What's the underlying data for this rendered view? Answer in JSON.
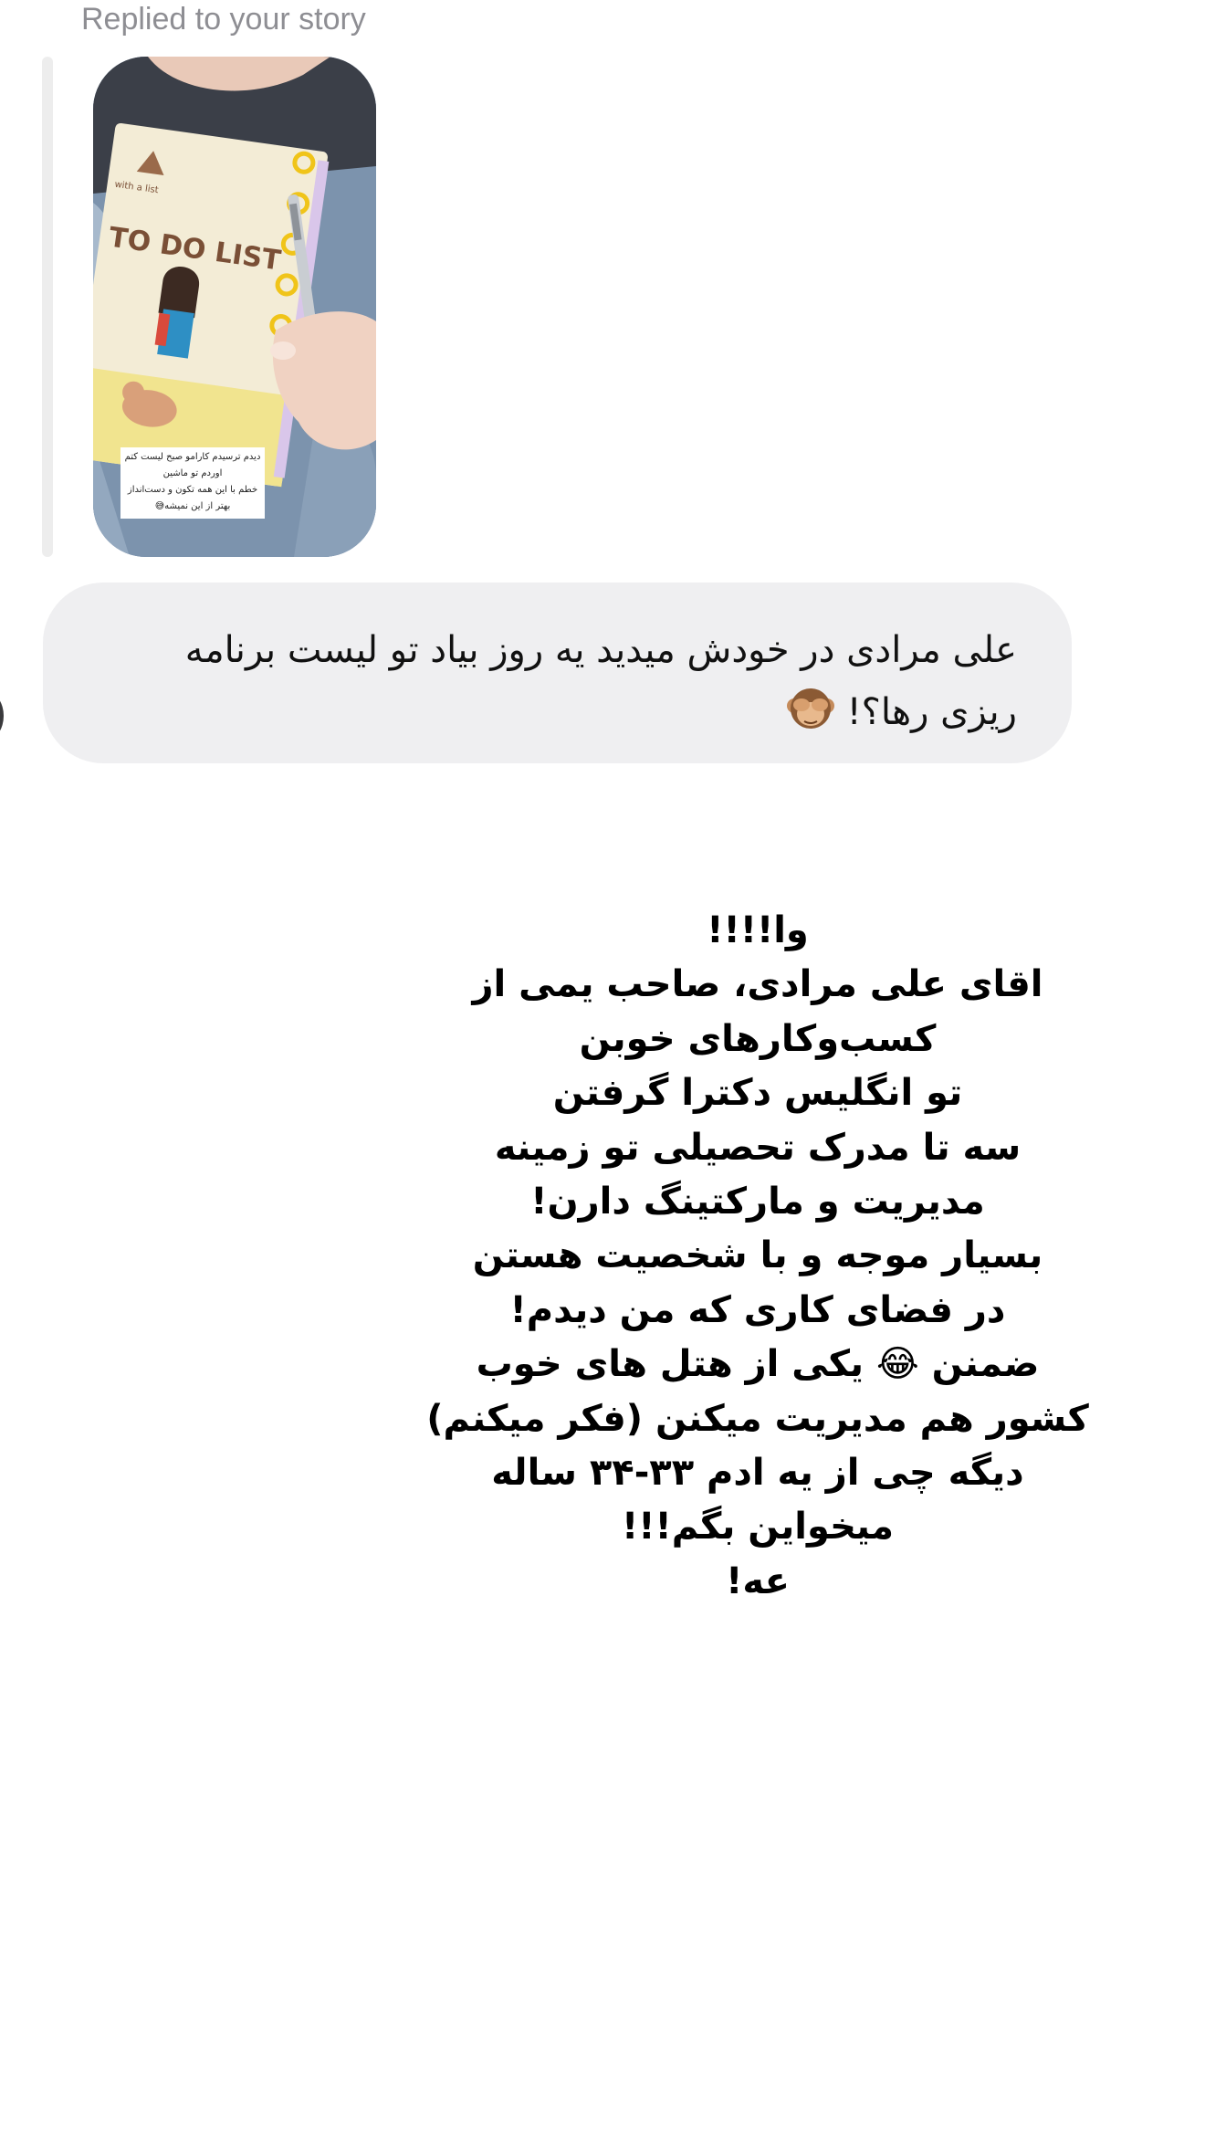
{
  "header": {
    "replied_label": "Replied to your story"
  },
  "story": {
    "thumbnail_caption": "دیدم ترسیدم کارامو صبح لیست کتم\nاوردم تو ماشین\nخطم با این همه تکون و دست‌انداز\nبهتر از این نمیشه😅",
    "notebook_title": "TO DO LIST",
    "notebook_subtitle": "with a list"
  },
  "message": {
    "text": "علی مرادی در خودش میدید یه روز بیاد تو لیست برنامه\nریزی رها؟!",
    "emoji": "see-no-evil-monkey"
  },
  "story_text": {
    "content": "وا!!!!\nاقای علی مرادی، صاحب یمی از\nکسب‌وکارهای خوبن\nتو انگلیس دکترا گرفتن\nسه تا مدرک تحصیلی تو زمینه\nمدیریت و مارکتینگ دارن!\nبسیار موجه و با شخصیت هستن\nدر فضای کاری که من دیدم!\nضمنن 😂 یکی از هتل های خوب\nکشور هم مدیریت میکنن (فکر میکنم)\nدیگه چی از یه ادم ۳۳-۳۴ ساله\nمیخواین بگم!!!\nعه!"
  },
  "colors": {
    "bubble": "#efeff1",
    "muted_text": "#8e8e93",
    "background": "#ffffff"
  }
}
